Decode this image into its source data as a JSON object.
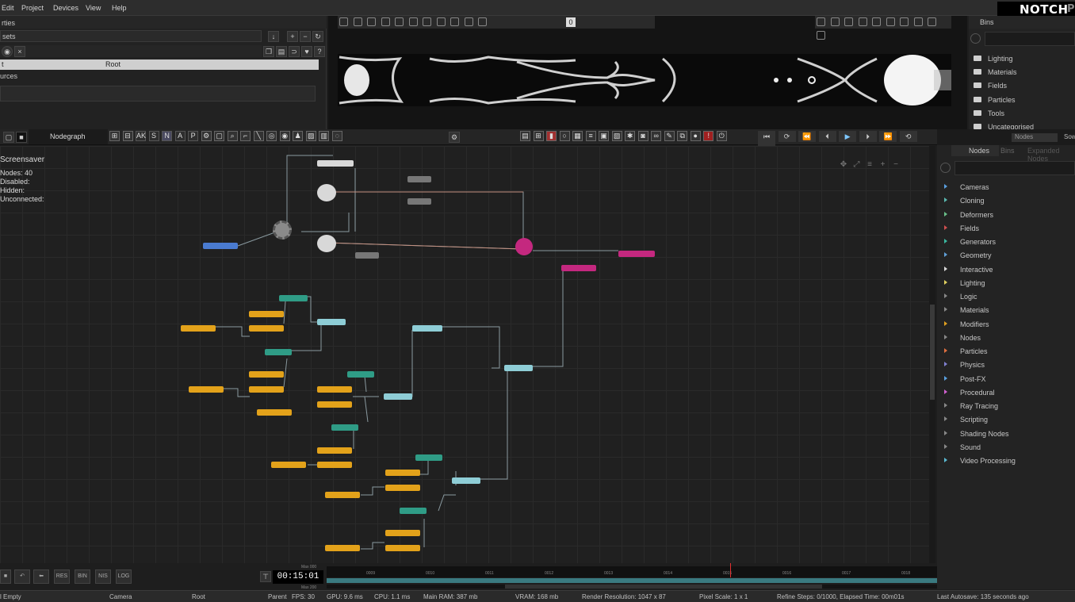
{
  "menu": [
    "Edit",
    "Project",
    "Devices",
    "View",
    "Help"
  ],
  "logo": {
    "text": "NOTCH",
    "suffix": "P"
  },
  "properties": {
    "title": "rties",
    "assets_label": "sets",
    "selected_row": {
      "col1": "t",
      "col2": "Root"
    },
    "sources_label": "urces"
  },
  "viewport": {
    "zero_label": "0"
  },
  "bins": {
    "title": "Bins",
    "items": [
      "Lighting",
      "Materials",
      "Fields",
      "Particles",
      "Tools",
      "Uncategorised"
    ]
  },
  "nodegraph": {
    "tab_label": "Nodegraph",
    "snap_letters": [
      "AK",
      "S",
      "N",
      "A",
      "P"
    ],
    "graph_title": "Screensaver",
    "stats": [
      {
        "label": "Nodes:",
        "value": "40"
      },
      {
        "label": "Disabled:",
        "value": ""
      },
      {
        "label": "Hidden:",
        "value": ""
      },
      {
        "label": "Unconnected:",
        "value": ""
      }
    ]
  },
  "nodes_panel": {
    "tabs": [
      "Nodes",
      "Bins",
      "Expanded Nodes"
    ],
    "dropdown": "Nodes",
    "dropdown2": "Sow",
    "categories": [
      {
        "name": "Cameras",
        "color": "#5aa0e0"
      },
      {
        "name": "Cloning",
        "color": "#5ab8b0"
      },
      {
        "name": "Deformers",
        "color": "#6ac08a"
      },
      {
        "name": "Fields",
        "color": "#d05050"
      },
      {
        "name": "Generators",
        "color": "#3ab8a0"
      },
      {
        "name": "Geometry",
        "color": "#60a0d8"
      },
      {
        "name": "Interactive",
        "color": "#d8d8d8"
      },
      {
        "name": "Lighting",
        "color": "#e0d060"
      },
      {
        "name": "Logic",
        "color": "#888888"
      },
      {
        "name": "Materials",
        "color": "#888888"
      },
      {
        "name": "Modifiers",
        "color": "#e0a020"
      },
      {
        "name": "Nodes",
        "color": "#888888"
      },
      {
        "name": "Particles",
        "color": "#e07040"
      },
      {
        "name": "Physics",
        "color": "#8080d0"
      },
      {
        "name": "Post-FX",
        "color": "#5aa0e0"
      },
      {
        "name": "Procedural",
        "color": "#d060d0"
      },
      {
        "name": "Ray Tracing",
        "color": "#888888"
      },
      {
        "name": "Scripting",
        "color": "#888888"
      },
      {
        "name": "Shading Nodes",
        "color": "#888888"
      },
      {
        "name": "Sound",
        "color": "#888888"
      },
      {
        "name": "Video Processing",
        "color": "#5ab8d0"
      }
    ]
  },
  "timeline": {
    "buttons": [
      "RES",
      "BIN",
      "NIS",
      "LOG"
    ],
    "timecode": "00:15:01",
    "max_label": "Max 000",
    "max_label2": "Max 200",
    "ruler_ticks": [
      "0009",
      "0010",
      "0011",
      "0012",
      "0013",
      "0014",
      "0015",
      "0016",
      "0017",
      "0018"
    ]
  },
  "status": {
    "item1": "l Empty",
    "camera": "Camera",
    "root": "Root",
    "parent": "Parent",
    "fps": "FPS: 30",
    "gpu": "GPU: 9.6 ms",
    "cpu": "CPU: 1.1 ms",
    "ram": "Main RAM: 387 mb",
    "vram": "VRAM: 168 mb",
    "resolution": "Render Resolution: 1047 x 87",
    "pixel_scale": "Pixel Scale: 1 x 1",
    "refine": "Refine Steps: 0/1000, Elapsed Time: 00m01s",
    "autosave": "Last Autosave: 135 seconds ago"
  }
}
